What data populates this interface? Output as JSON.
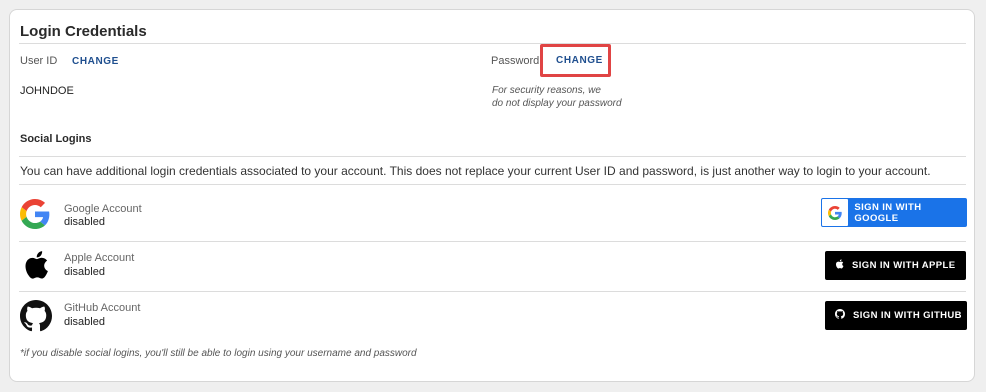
{
  "credentials": {
    "title": "Login Credentials",
    "user_id_label": "User ID",
    "user_id_change": "CHANGE",
    "user_id_value": "JOHNDOE",
    "password_label": "Password",
    "password_change": "CHANGE",
    "password_note_line1": "For security reasons, we",
    "password_note_line2": "do not display your password",
    "highlight_color": "#e04444"
  },
  "social": {
    "title": "Social Logins",
    "description": "You can have additional login credentials associated to your account. This does not replace your current User ID and password, is just another way to login to your account.",
    "accounts": [
      {
        "name": "Google Account",
        "status": "disabled",
        "button": "SIGN IN WITH GOOGLE",
        "icon": "google-logo-icon",
        "color": "#1a73e8"
      },
      {
        "name": "Apple Account",
        "status": "disabled",
        "button": "SIGN IN WITH APPLE",
        "icon": "apple-logo-icon",
        "color": "#000000"
      },
      {
        "name": "GitHub Account",
        "status": "disabled",
        "button": "SIGN IN WITH GITHUB",
        "icon": "github-logo-icon",
        "color": "#000000"
      }
    ],
    "footnote": "*if you disable social logins, you'll still be able to login using your username and password"
  }
}
